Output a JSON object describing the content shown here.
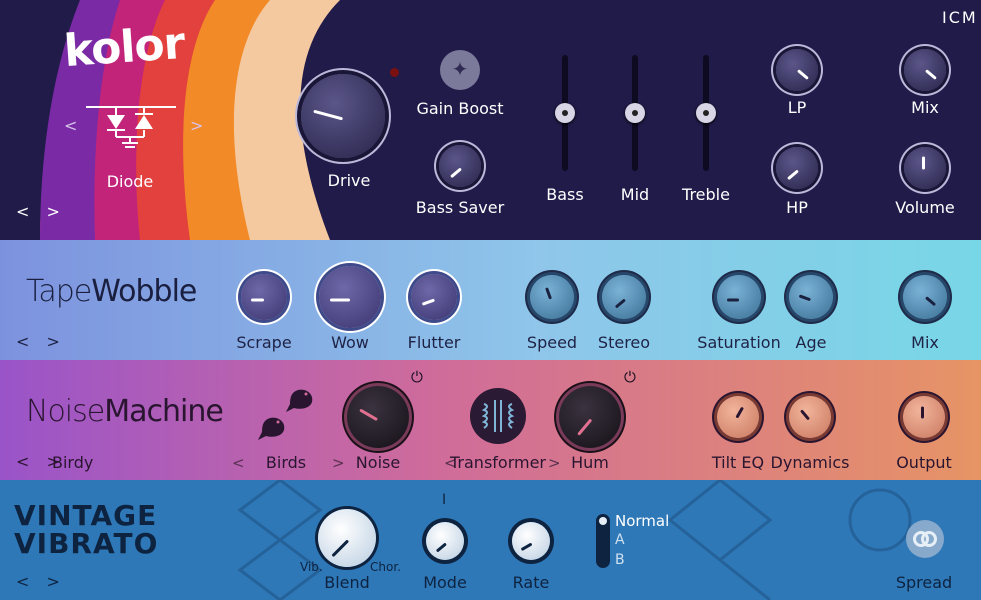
{
  "kolor": {
    "logo": "kolor",
    "brand_corner": "ICM",
    "circuit_label": "Diode",
    "nav": "< >",
    "arrow_left": "<",
    "arrow_right": ">",
    "drive_label": "Drive",
    "gain_boost_label": "Gain Boost",
    "bass_saver_label": "Bass Saver",
    "bass_label": "Bass",
    "mid_label": "Mid",
    "treble_label": "Treble",
    "lp_label": "LP",
    "hp_label": "HP",
    "mix_label": "Mix",
    "volume_label": "Volume",
    "colors": {
      "bg": "#211b4a",
      "stripe_purple": "#7a2aa5",
      "stripe_magenta": "#c2247a",
      "stripe_red": "#e2413e",
      "stripe_orange": "#f28a27",
      "stripe_peach": "#f5c9a0"
    }
  },
  "tapewobble": {
    "title_a": "Tape",
    "title_b": "Wobble",
    "nav": "< >",
    "knobs": {
      "scrape": "Scrape",
      "wow": "Wow",
      "flutter": "Flutter",
      "speed": "Speed",
      "stereo": "Stereo",
      "saturation": "Saturation",
      "age": "Age",
      "mix": "Mix"
    }
  },
  "noisemachine": {
    "title_a": "Noise",
    "title_b": "Machine",
    "nav": "< >",
    "preset": "Birdy",
    "birds_label": "Birds",
    "noise_label": "Noise",
    "transformer_label": "Transformer",
    "hum_label": "Hum",
    "tilt_eq_label": "Tilt EQ",
    "dynamics_label": "Dynamics",
    "output_label": "Output",
    "power_icon": "⏻",
    "arrow_left": "<",
    "arrow_right": ">"
  },
  "vintagevibrato": {
    "title_line1": "VINTAGE",
    "title_line2": "VIBRATO",
    "nav": "< >",
    "blend_label": "Blend",
    "blend_left": "Vib.",
    "blend_right": "Chor.",
    "mode_label": "Mode",
    "mode_marker": "I",
    "rate_label": "Rate",
    "switch_options": [
      "Normal",
      "A",
      "B"
    ],
    "spread_label": "Spread"
  }
}
